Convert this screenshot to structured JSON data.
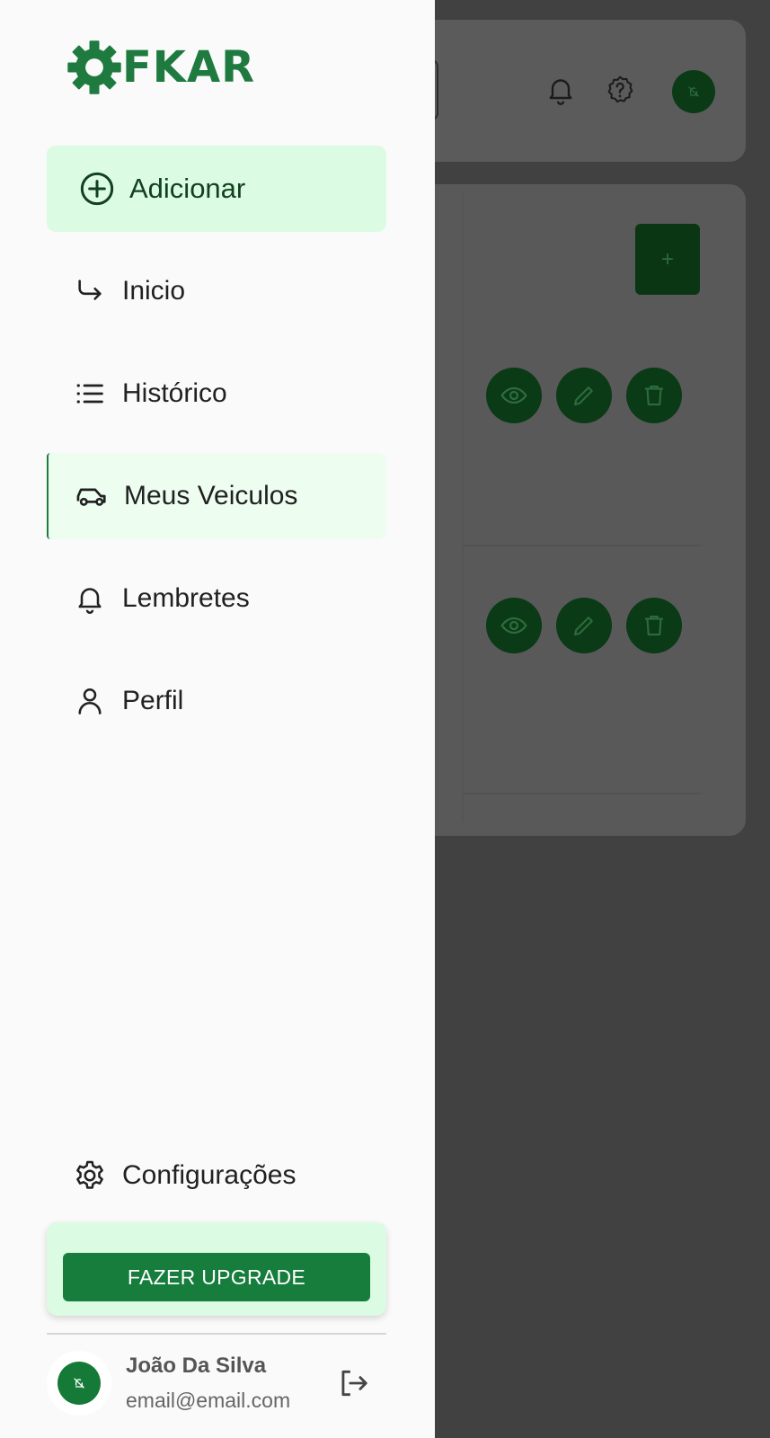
{
  "brand": {
    "name": "FKAR",
    "color": "#1e7a3f"
  },
  "nav": {
    "add_label": "Adicionar",
    "items": [
      {
        "label": "Inicio",
        "icon": "arrow-turn-icon"
      },
      {
        "label": "Histórico",
        "icon": "list-icon"
      },
      {
        "label": "Meus Veiculos",
        "icon": "car-icon",
        "active": true
      },
      {
        "label": "Lembretes",
        "icon": "bell-icon"
      },
      {
        "label": "Perfil",
        "icon": "user-icon"
      }
    ],
    "settings_label": "Configurações"
  },
  "upgrade": {
    "button_label": "FAZER UPGRADE"
  },
  "user": {
    "name": "João Da Silva",
    "email": "email@email.com"
  },
  "background": {
    "add_button_label": "+"
  },
  "colors": {
    "accent": "#167d3c",
    "add_bg": "#dcfbe3",
    "active_bg": "#edfdf0",
    "overlay": "#414141"
  }
}
